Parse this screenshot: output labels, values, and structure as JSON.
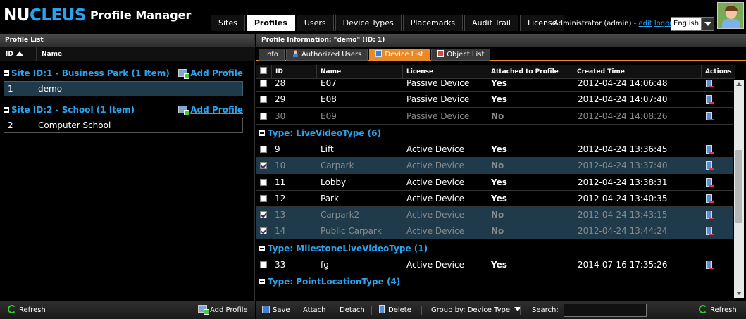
{
  "header": {
    "logo_nu": "NU",
    "logo_cleus": "CLEUS",
    "app_title": "Profile Manager",
    "tabs": [
      {
        "label": "Sites"
      },
      {
        "label": "Profiles"
      },
      {
        "label": "Users"
      },
      {
        "label": "Device Types"
      },
      {
        "label": "Placemarks"
      },
      {
        "label": "Audit Trail"
      },
      {
        "label": "License"
      }
    ],
    "active_tab": "Profiles",
    "user_text": "Administrator (admin) - ",
    "edit_link": "edit",
    "logout_link": "logout",
    "language": "English"
  },
  "left": {
    "title": "Profile List",
    "col_id": "ID",
    "col_name": "Name",
    "groups": [
      {
        "label": "Site ID:1 - Business Park (1 Item)",
        "add": "Add Profile",
        "rows": [
          {
            "id": "1",
            "name": "demo",
            "selected": true
          }
        ]
      },
      {
        "label": "Site ID:2 - School (1 Item)",
        "add": "Add Profile",
        "rows": [
          {
            "id": "2",
            "name": "Computer School",
            "selected": false
          }
        ]
      }
    ],
    "footer": {
      "refresh": "Refresh",
      "add_profile": "Add Profile"
    }
  },
  "right": {
    "title": "Profile Information: \"demo\" (ID: 1)",
    "subtabs": [
      {
        "label": "Info",
        "icon": "none"
      },
      {
        "label": "Authorized Users",
        "icon": "users-icon"
      },
      {
        "label": "Device List",
        "icon": "device-icon"
      },
      {
        "label": "Object List",
        "icon": "object-icon"
      }
    ],
    "active_subtab": "Device List",
    "columns": [
      "ID",
      "Name",
      "License",
      "Attached to Profile",
      "Created Time",
      "Actions"
    ],
    "top_rows": [
      {
        "id": "28",
        "name": "E07",
        "license": "Passive Device",
        "attached": "Yes",
        "created": "2012-04-24 14:06:48",
        "checked": false,
        "selected": false
      },
      {
        "id": "29",
        "name": "E08",
        "license": "Passive Device",
        "attached": "Yes",
        "created": "2012-04-24 14:07:40",
        "checked": false,
        "selected": false
      },
      {
        "id": "30",
        "name": "E09",
        "license": "Passive Device",
        "attached": "No",
        "created": "2012-04-24 14:08:26",
        "checked": false,
        "selected": false
      }
    ],
    "groups": [
      {
        "label": "Type: LiveVideoType (6)",
        "rows": [
          {
            "id": "9",
            "name": "Lift",
            "license": "Active Device",
            "attached": "Yes",
            "created": "2012-04-24 13:36:45",
            "checked": false,
            "selected": false
          },
          {
            "id": "10",
            "name": "Carpark",
            "license": "Active Device",
            "attached": "No",
            "created": "2012-04-24 13:37:40",
            "checked": true,
            "selected": true
          },
          {
            "id": "11",
            "name": "Lobby",
            "license": "Active Device",
            "attached": "Yes",
            "created": "2012-04-24 13:38:31",
            "checked": false,
            "selected": false
          },
          {
            "id": "12",
            "name": "Park",
            "license": "Active Device",
            "attached": "Yes",
            "created": "2012-04-24 13:40:35",
            "checked": false,
            "selected": false
          },
          {
            "id": "13",
            "name": "Carpark2",
            "license": "Active Device",
            "attached": "No",
            "created": "2012-04-24 13:43:15",
            "checked": true,
            "selected": true
          },
          {
            "id": "14",
            "name": "Public Carpark",
            "license": "Active Device",
            "attached": "No",
            "created": "2012-04-24 13:44:24",
            "checked": true,
            "selected": true
          }
        ]
      },
      {
        "label": "Type: MilestoneLiveVideoType (1)",
        "rows": [
          {
            "id": "33",
            "name": "fg",
            "license": "Active Device",
            "attached": "Yes",
            "created": "2014-07-16 17:35:26",
            "checked": false,
            "selected": false
          }
        ]
      },
      {
        "label": "Type: PointLocationType (4)",
        "rows": []
      }
    ],
    "footer": {
      "save": "Save",
      "attach": "Attach",
      "detach": "Detach",
      "delete": "Delete",
      "group_by": "Group by: Device Type",
      "search_label": "Search:",
      "search_value": "",
      "refresh": "Refresh"
    }
  },
  "colors": {
    "accent_blue": "#2aa3ee",
    "active_orange": "#e98a26",
    "selected_row": "#1f3a4a"
  }
}
